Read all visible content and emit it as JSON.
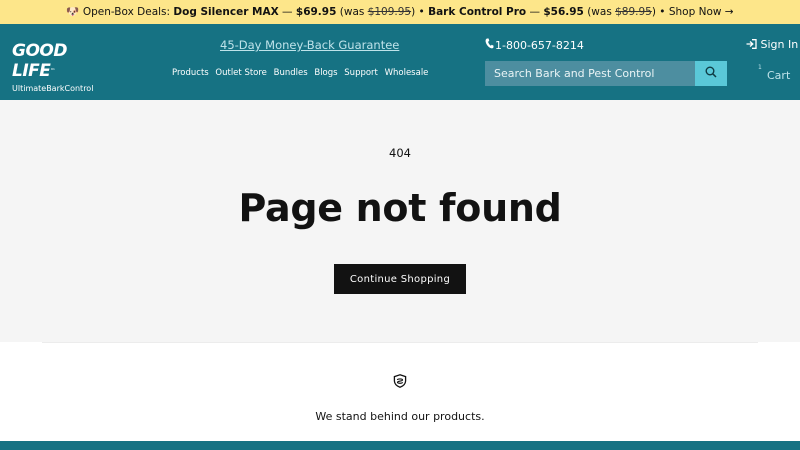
{
  "announcement": {
    "emoji": "🐶",
    "prefix": "Open-Box Deals: ",
    "item1": "Dog Silencer MAX",
    "sep1": " — ",
    "price1": "$69.95",
    "was_prefix1": " (was ",
    "was1": "$109.95",
    "was_suffix1": ") • ",
    "item2": "Bark Control Pro",
    "sep2": " — ",
    "price2": "$56.95",
    "was_prefix2": " (was ",
    "was2": "$89.95",
    "was_suffix2": ") • ",
    "cta": "Shop Now →"
  },
  "header": {
    "logo_main": "GOOD LIFE",
    "logo_tm": "™",
    "logo_sub": "UltimateBarkControl",
    "guarantee": "45-Day Money-Back Guarantee",
    "phone": "1-800-657-8214",
    "sign_in": "Sign In",
    "nav": [
      "Products",
      "Outlet Store",
      "Bundles",
      "Blogs",
      "Support",
      "Wholesale"
    ],
    "search_placeholder": "Search Bark and Pest Control",
    "cart_count": "1",
    "cart_label": "Cart"
  },
  "main": {
    "code": "404",
    "title": "Page not found",
    "button": "Continue Shopping"
  },
  "trust": {
    "icon": "shield-icon",
    "text": "We stand behind our products."
  },
  "colors": {
    "header_bg": "#167283",
    "announce_bg": "#fde68a",
    "search_bg": "#4d8ea0",
    "search_btn": "#5ac8d8",
    "button_bg": "#121212"
  }
}
